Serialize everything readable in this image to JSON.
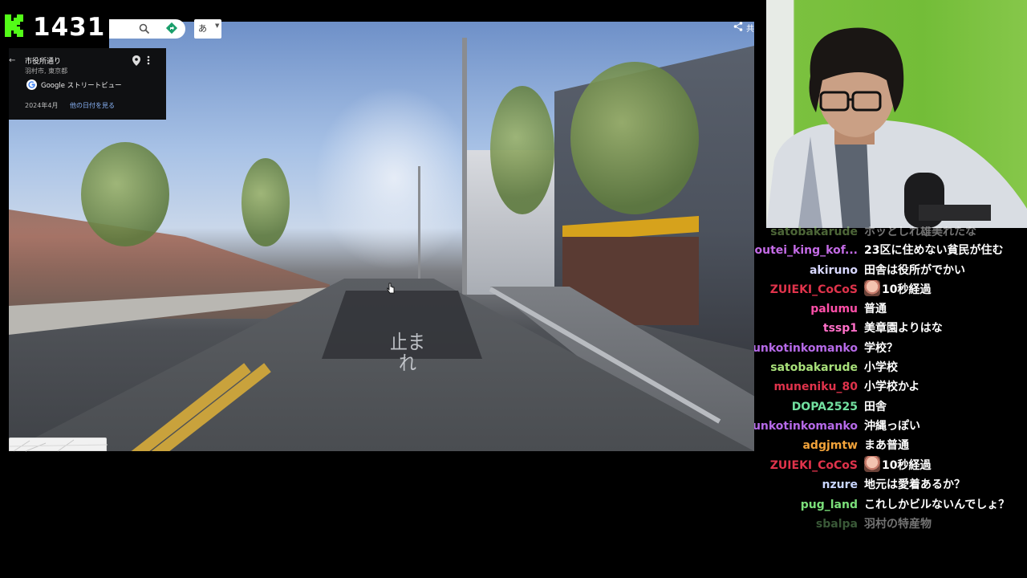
{
  "counter": "1431",
  "search": {
    "lang_label": "あ"
  },
  "share": {
    "label": "共"
  },
  "info_card": {
    "title": "市役所通り",
    "subtitle": "羽村市, 東京都",
    "provider": "Google ストリートビュー",
    "date": "2024年4月",
    "other_dates_link": "他の日付を見る"
  },
  "street_view": {
    "road_marking": "止まれ"
  },
  "chat": {
    "messages": [
      {
        "name": "satobakarude",
        "name_color": "#a8e07a",
        "message": "ホッとしれ雄美れたな",
        "faded": true
      },
      {
        "name": "doutei_king_kof...",
        "name_color": "#c46be6",
        "message": "23区に住めない貧民が住む"
      },
      {
        "name": "akiruno",
        "name_color": "#d8d8ff",
        "message": "田舎は役所がでかい"
      },
      {
        "name": "ZUIEKI_CoCoS",
        "name_color": "#e0334b",
        "message": "10秒経過",
        "emote": true
      },
      {
        "name": "palumu",
        "name_color": "#ff4fa8",
        "message": "普通"
      },
      {
        "name": "tssp1",
        "name_color": "#ff6fc8",
        "message": "美章園よりはな"
      },
      {
        "name": "unkotinkomanko",
        "name_color": "#b66ae8",
        "message": "学校？"
      },
      {
        "name": "satobakarude",
        "name_color": "#a8e07a",
        "message": "小学校"
      },
      {
        "name": "muneniku_80",
        "name_color": "#e0334b",
        "message": "小学校かよ"
      },
      {
        "name": "DOPA2525",
        "name_color": "#72e0a0",
        "message": "田舎"
      },
      {
        "name": "unkotinkomanko",
        "name_color": "#b66ae8",
        "message": "沖縄っぽい"
      },
      {
        "name": "adgjmtw",
        "name_color": "#f2a33a",
        "message": "まあ普通"
      },
      {
        "name": "ZUIEKI_CoCoS",
        "name_color": "#e0334b",
        "message": "10秒経過",
        "emote": true
      },
      {
        "name": "nzure",
        "name_color": "#c9d6ff",
        "message": "地元は愛着あるか？"
      },
      {
        "name": "pug_land",
        "name_color": "#7be07a",
        "message": "これしかビルないんでしょ？"
      },
      {
        "name": "sbalpa",
        "name_color": "#7ec47a",
        "message": "羽村の特産物",
        "faded": true
      }
    ]
  },
  "colors": {
    "brand_green": "#53fc18",
    "link_blue": "#8ab4f8"
  }
}
